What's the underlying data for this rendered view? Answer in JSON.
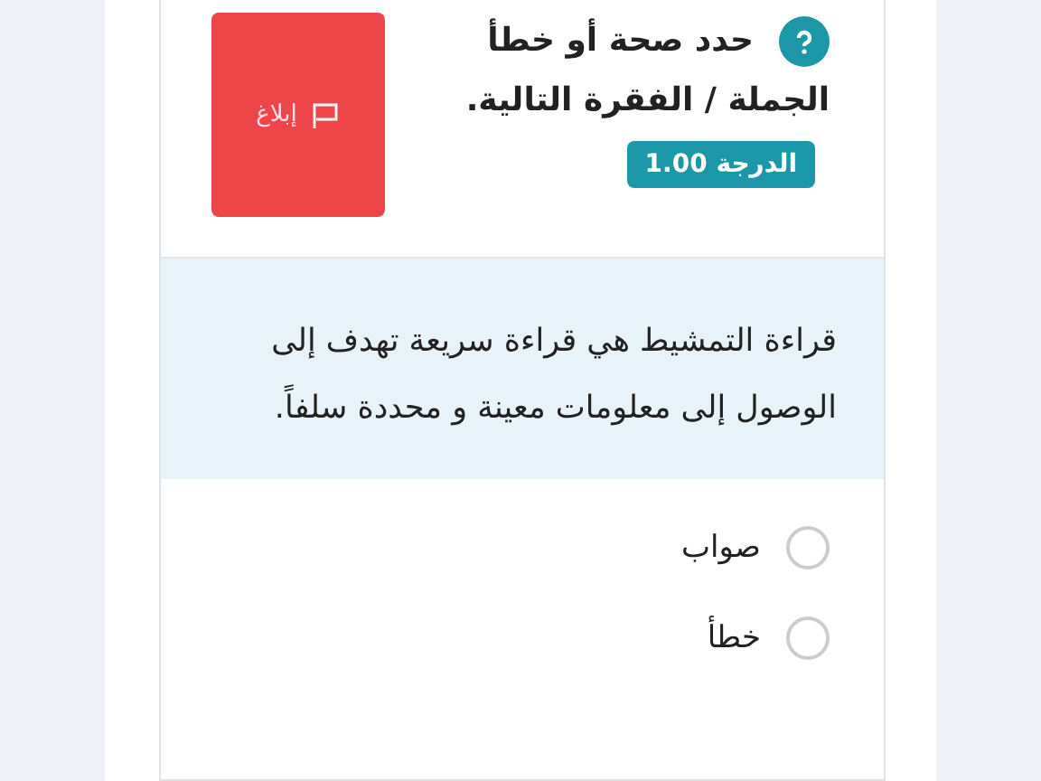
{
  "question": {
    "title_lines": [
      "حدد صحة أو خطأ",
      "الجملة / الفقرة التالية."
    ],
    "grade": "الدرجة 1.00",
    "report_button": "إبلاغ"
  },
  "passage": "قراءة التمشيط هي قراءة سريعة تهدف إلى الوصول إلى معلومات معينة و محددة سلفاً.",
  "options": [
    {
      "label": "صواب",
      "selected": false
    },
    {
      "label": "خطأ",
      "selected": false
    }
  ]
}
